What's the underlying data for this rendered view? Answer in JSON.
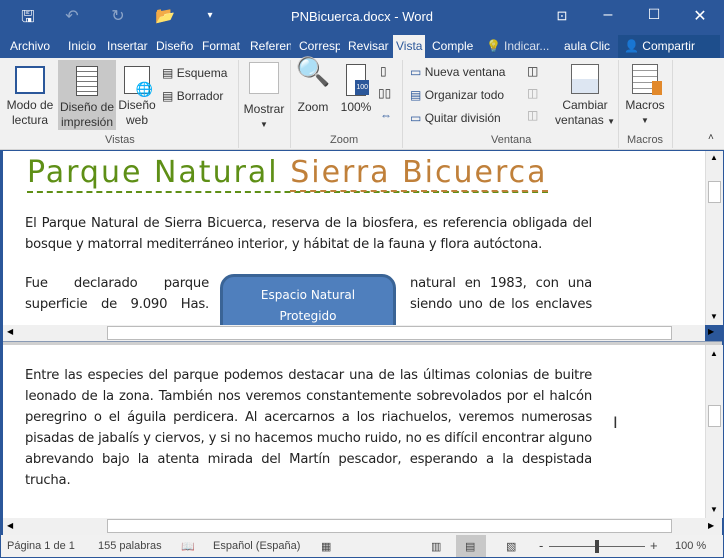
{
  "window": {
    "title": "PNBicuerca.docx - Word"
  },
  "tabs": [
    {
      "label": "Archivo"
    },
    {
      "label": "Inicio"
    },
    {
      "label": "Insertar"
    },
    {
      "label": "Diseño"
    },
    {
      "label": "Format"
    },
    {
      "label": "Referen"
    },
    {
      "label": "Corresp"
    },
    {
      "label": "Revisar"
    },
    {
      "label": "Vista"
    },
    {
      "label": "Comple"
    },
    {
      "label": "Indicar..."
    },
    {
      "label": "aula Clic"
    }
  ],
  "share_label": "Compartir",
  "ribbon": {
    "vistas": {
      "label": "Vistas",
      "modo_lectura": "Modo de lectura",
      "diseno_impresion": "Diseño de impresión",
      "diseno_web": "Diseño web",
      "esquema": "Esquema",
      "borrador": "Borrador"
    },
    "mostrar": "Mostrar",
    "zoom": {
      "label": "Zoom",
      "zoom": "Zoom",
      "pct": "100%"
    },
    "ventana": {
      "label": "Ventana",
      "nueva": "Nueva ventana",
      "organizar": "Organizar todo",
      "quitar": "Quitar división",
      "cambiar": "Cambiar ventanas"
    },
    "macros": {
      "label": "Macros",
      "macros": "Macros"
    }
  },
  "document": {
    "title_a": "Parque Natural ",
    "title_b": "Sierra Bicuerca",
    "title_colors": {
      "a": "#5e8f16",
      "b": "#c0803a"
    },
    "para1": "El Parque Natural de Sierra Bicuerca, reserva de la biosfera, es referencia obligada del bosque y matorral mediterráneo interior, y hábitat de la fauna y flora autóctona.",
    "para2_left": "Fue declarado parque superficie de 9.090 Has.",
    "para2_right": "natural en 1983, con una siendo uno de los enclaves",
    "shape_text": "Espacio Natural Protegido",
    "para3": "Entre las especies del parque podemos destacar una de las últimas colonias de buitre leonado de la zona. También nos veremos constantemente sobrevolados por el halcón peregrino o el águila perdicera. Al acercarnos a los riachuelos, veremos numerosas pisadas de jabalís y ciervos, y si no hacemos mucho ruido, no es difícil encontrar alguno abrevando bajo la atenta mirada del Martín pescador, esperando a la despistada trucha."
  },
  "status": {
    "page": "Página 1 de 1",
    "words": "155 palabras",
    "language": "Español (España)",
    "zoom": "100 %",
    "zoom_value": 100
  }
}
